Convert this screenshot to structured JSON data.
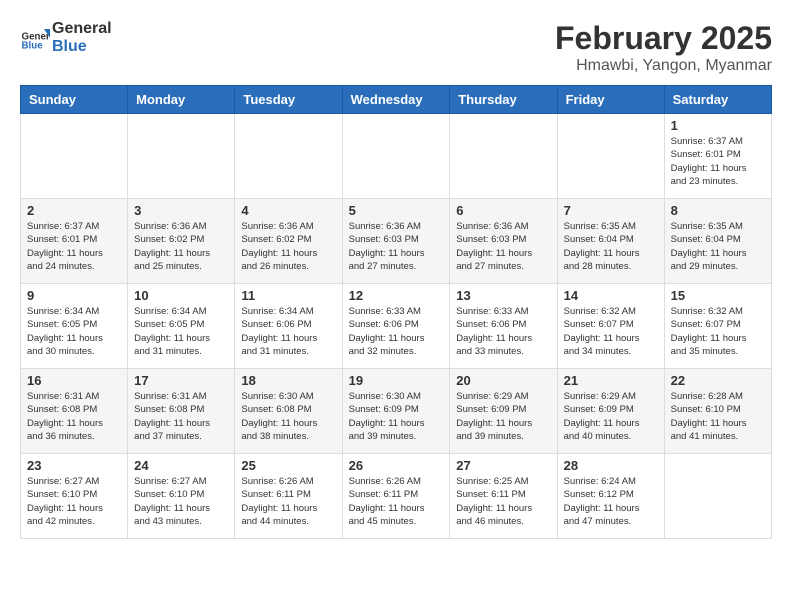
{
  "header": {
    "logo_general": "General",
    "logo_blue": "Blue",
    "title": "February 2025",
    "subtitle": "Hmawbi, Yangon, Myanmar"
  },
  "calendar": {
    "days_of_week": [
      "Sunday",
      "Monday",
      "Tuesday",
      "Wednesday",
      "Thursday",
      "Friday",
      "Saturday"
    ],
    "weeks": [
      [
        {
          "day": "",
          "info": ""
        },
        {
          "day": "",
          "info": ""
        },
        {
          "day": "",
          "info": ""
        },
        {
          "day": "",
          "info": ""
        },
        {
          "day": "",
          "info": ""
        },
        {
          "day": "",
          "info": ""
        },
        {
          "day": "1",
          "info": "Sunrise: 6:37 AM\nSunset: 6:01 PM\nDaylight: 11 hours\nand 23 minutes."
        }
      ],
      [
        {
          "day": "2",
          "info": "Sunrise: 6:37 AM\nSunset: 6:01 PM\nDaylight: 11 hours\nand 24 minutes."
        },
        {
          "day": "3",
          "info": "Sunrise: 6:36 AM\nSunset: 6:02 PM\nDaylight: 11 hours\nand 25 minutes."
        },
        {
          "day": "4",
          "info": "Sunrise: 6:36 AM\nSunset: 6:02 PM\nDaylight: 11 hours\nand 26 minutes."
        },
        {
          "day": "5",
          "info": "Sunrise: 6:36 AM\nSunset: 6:03 PM\nDaylight: 11 hours\nand 27 minutes."
        },
        {
          "day": "6",
          "info": "Sunrise: 6:36 AM\nSunset: 6:03 PM\nDaylight: 11 hours\nand 27 minutes."
        },
        {
          "day": "7",
          "info": "Sunrise: 6:35 AM\nSunset: 6:04 PM\nDaylight: 11 hours\nand 28 minutes."
        },
        {
          "day": "8",
          "info": "Sunrise: 6:35 AM\nSunset: 6:04 PM\nDaylight: 11 hours\nand 29 minutes."
        }
      ],
      [
        {
          "day": "9",
          "info": "Sunrise: 6:34 AM\nSunset: 6:05 PM\nDaylight: 11 hours\nand 30 minutes."
        },
        {
          "day": "10",
          "info": "Sunrise: 6:34 AM\nSunset: 6:05 PM\nDaylight: 11 hours\nand 31 minutes."
        },
        {
          "day": "11",
          "info": "Sunrise: 6:34 AM\nSunset: 6:06 PM\nDaylight: 11 hours\nand 31 minutes."
        },
        {
          "day": "12",
          "info": "Sunrise: 6:33 AM\nSunset: 6:06 PM\nDaylight: 11 hours\nand 32 minutes."
        },
        {
          "day": "13",
          "info": "Sunrise: 6:33 AM\nSunset: 6:06 PM\nDaylight: 11 hours\nand 33 minutes."
        },
        {
          "day": "14",
          "info": "Sunrise: 6:32 AM\nSunset: 6:07 PM\nDaylight: 11 hours\nand 34 minutes."
        },
        {
          "day": "15",
          "info": "Sunrise: 6:32 AM\nSunset: 6:07 PM\nDaylight: 11 hours\nand 35 minutes."
        }
      ],
      [
        {
          "day": "16",
          "info": "Sunrise: 6:31 AM\nSunset: 6:08 PM\nDaylight: 11 hours\nand 36 minutes."
        },
        {
          "day": "17",
          "info": "Sunrise: 6:31 AM\nSunset: 6:08 PM\nDaylight: 11 hours\nand 37 minutes."
        },
        {
          "day": "18",
          "info": "Sunrise: 6:30 AM\nSunset: 6:08 PM\nDaylight: 11 hours\nand 38 minutes."
        },
        {
          "day": "19",
          "info": "Sunrise: 6:30 AM\nSunset: 6:09 PM\nDaylight: 11 hours\nand 39 minutes."
        },
        {
          "day": "20",
          "info": "Sunrise: 6:29 AM\nSunset: 6:09 PM\nDaylight: 11 hours\nand 39 minutes."
        },
        {
          "day": "21",
          "info": "Sunrise: 6:29 AM\nSunset: 6:09 PM\nDaylight: 11 hours\nand 40 minutes."
        },
        {
          "day": "22",
          "info": "Sunrise: 6:28 AM\nSunset: 6:10 PM\nDaylight: 11 hours\nand 41 minutes."
        }
      ],
      [
        {
          "day": "23",
          "info": "Sunrise: 6:27 AM\nSunset: 6:10 PM\nDaylight: 11 hours\nand 42 minutes."
        },
        {
          "day": "24",
          "info": "Sunrise: 6:27 AM\nSunset: 6:10 PM\nDaylight: 11 hours\nand 43 minutes."
        },
        {
          "day": "25",
          "info": "Sunrise: 6:26 AM\nSunset: 6:11 PM\nDaylight: 11 hours\nand 44 minutes."
        },
        {
          "day": "26",
          "info": "Sunrise: 6:26 AM\nSunset: 6:11 PM\nDaylight: 11 hours\nand 45 minutes."
        },
        {
          "day": "27",
          "info": "Sunrise: 6:25 AM\nSunset: 6:11 PM\nDaylight: 11 hours\nand 46 minutes."
        },
        {
          "day": "28",
          "info": "Sunrise: 6:24 AM\nSunset: 6:12 PM\nDaylight: 11 hours\nand 47 minutes."
        },
        {
          "day": "",
          "info": ""
        }
      ]
    ]
  }
}
